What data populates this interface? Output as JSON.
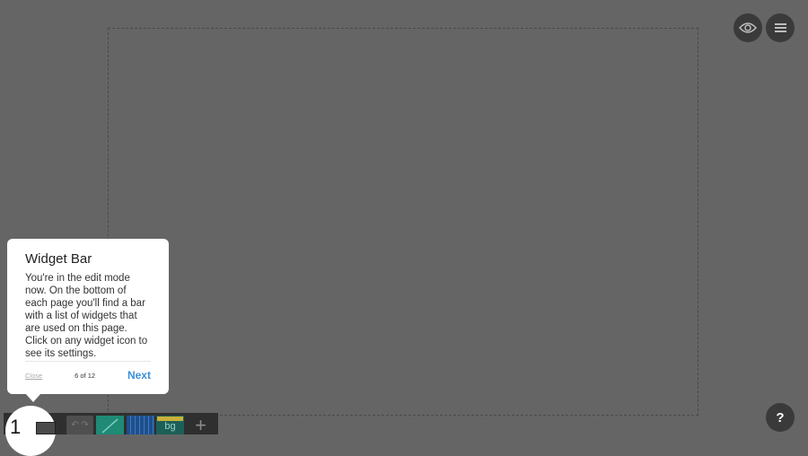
{
  "header": {
    "preview_icon": "eye-icon",
    "menu_icon": "hamburger-menu-icon"
  },
  "popover": {
    "title": "Widget Bar",
    "body": "You're in the edit mode now. On the bottom of each page you'll find a bar with a list of widgets that are used on this page. Click on any widget icon to see its settings.",
    "close_label": "Close",
    "counter": "6 of 12",
    "next_label": "Next"
  },
  "widget_bar": {
    "highlight_number": "1",
    "bg_widget_label": "bg",
    "add_label": "+"
  },
  "help": {
    "label": "?"
  },
  "colors": {
    "background": "#656565",
    "accent_link": "#3a8fd8",
    "widget_line": "#1f8a76",
    "widget_grid": "#1f4f8a",
    "widget_bg": "#1c5f57"
  }
}
